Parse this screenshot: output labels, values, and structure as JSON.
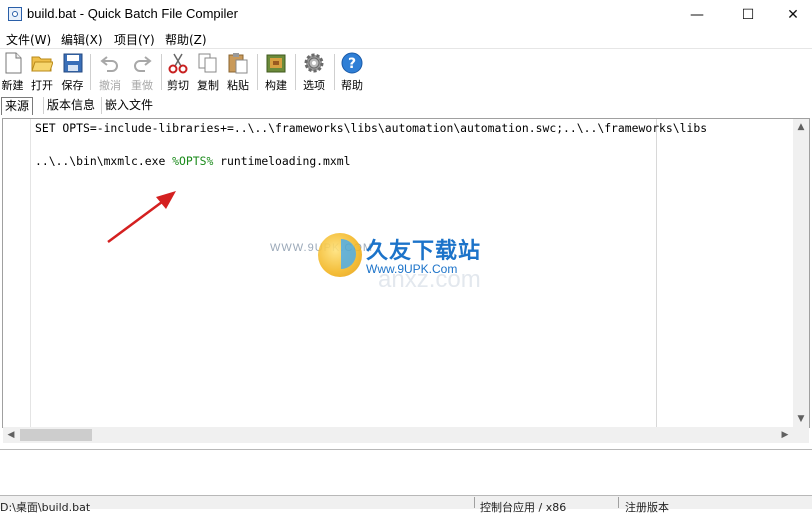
{
  "window": {
    "title": "build.bat - Quick Batch File Compiler",
    "minimize_glyph": "—",
    "maximize_glyph": "☐",
    "close_glyph": "✕"
  },
  "menu": [
    {
      "label": "文件(W)"
    },
    {
      "label": "编辑(X)"
    },
    {
      "label": "项目(Y)"
    },
    {
      "label": "帮助(Z)"
    }
  ],
  "toolbar": {
    "new": {
      "label": "新建",
      "icon": "new-file-icon"
    },
    "open": {
      "label": "打开",
      "icon": "folder-open-icon"
    },
    "save": {
      "label": "保存",
      "icon": "floppy-disk-icon"
    },
    "undo": {
      "label": "撤消",
      "icon": "undo-icon",
      "enabled": false
    },
    "redo": {
      "label": "重做",
      "icon": "redo-icon",
      "enabled": false
    },
    "cut": {
      "label": "剪切",
      "icon": "scissors-icon"
    },
    "copy": {
      "label": "复制",
      "icon": "copy-icon"
    },
    "paste": {
      "label": "粘贴",
      "icon": "paste-icon"
    },
    "build": {
      "label": "构建",
      "icon": "build-icon"
    },
    "options": {
      "label": "选项",
      "icon": "gear-icon"
    },
    "help": {
      "label": "帮助",
      "icon": "help-icon"
    }
  },
  "tabs": [
    {
      "label": "来源",
      "active": true
    },
    {
      "label": "版本信息",
      "active": false
    },
    {
      "label": "嵌入文件",
      "active": false
    }
  ],
  "editor": {
    "line1": "SET OPTS=-include-libraries+=..\\..\\frameworks\\libs\\automation\\automation.swc;..\\..\\frameworks\\libs",
    "line2_prefix": "..\\..\\bin\\mxmlc.exe ",
    "line2_var": "%OPTS%",
    "line2_suffix": " runtimeloading.mxml"
  },
  "watermark": {
    "name": "久友下载站",
    "url": "Www.9UPK.Com",
    "url_small": "WWW.9UPK.COM",
    "ghost": "anxz.com"
  },
  "status": {
    "path": "D:\\桌面\\build.bat",
    "app_type": "控制台应用 / x86",
    "registration": "注册版本"
  },
  "colors": {
    "variable": "#1a8a1a",
    "arrow": "#d42020",
    "watermark_blue": "#1c73c9"
  }
}
